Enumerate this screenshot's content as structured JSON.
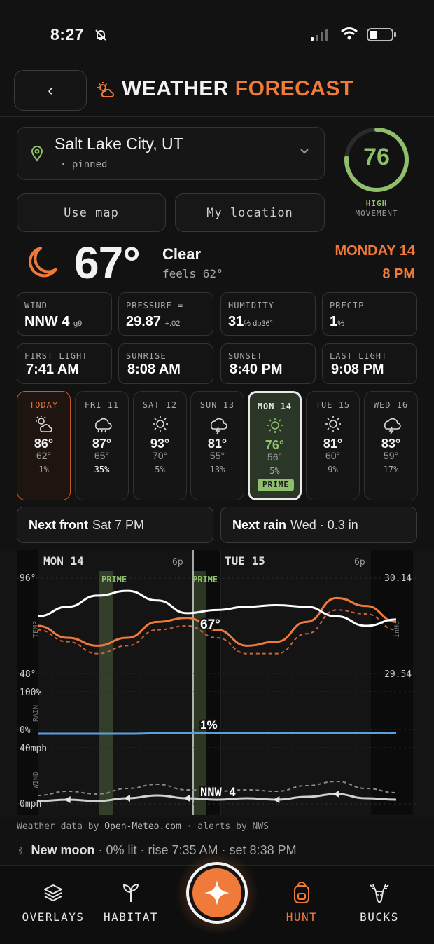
{
  "status": {
    "time": "8:27"
  },
  "header": {
    "title_main": "WEATHER",
    "title_accent": "FORECAST"
  },
  "location": {
    "name": "Salt Lake City, UT",
    "sub": "· pinned"
  },
  "movement": {
    "score": "76",
    "level": "HIGH",
    "label": "MOVEMENT",
    "fraction": 0.76
  },
  "buttons": {
    "use_map": "Use map",
    "my_location": "My location"
  },
  "current": {
    "temp": "67°",
    "condition": "Clear",
    "feels": "feels 62°",
    "date_day": "MONDAY 14",
    "date_time": "8 PM"
  },
  "tiles": [
    {
      "label": "WIND",
      "value": "NNW 4",
      "extra": "g9"
    },
    {
      "label": "PRESSURE =",
      "value": "29.87",
      "extra": "+.02"
    },
    {
      "label": "HUMIDITY",
      "value": "31",
      "extra": "% dp36°"
    },
    {
      "label": "PRECIP",
      "value": "1",
      "extra": "%"
    }
  ],
  "light": [
    {
      "label": "FIRST LIGHT",
      "value": "7:41 AM"
    },
    {
      "label": "SUNRISE",
      "value": "8:08 AM"
    },
    {
      "label": "SUNSET",
      "value": "8:40 PM"
    },
    {
      "label": "LAST LIGHT",
      "value": "9:08 PM"
    }
  ],
  "days": [
    {
      "name": "TODAY",
      "icon": "partly-cloudy-icon",
      "high": "86°",
      "low": "62°",
      "precip": "1%"
    },
    {
      "name": "FRI 11",
      "icon": "rain-cloud-icon",
      "high": "87°",
      "low": "65°",
      "precip": "35%"
    },
    {
      "name": "SAT 12",
      "icon": "sun-icon",
      "high": "93°",
      "low": "70°",
      "precip": "5%"
    },
    {
      "name": "SUN 13",
      "icon": "thunder-cloud-icon",
      "high": "81°",
      "low": "55°",
      "precip": "13%"
    },
    {
      "name": "MON 14",
      "icon": "sun-icon",
      "high": "76°",
      "low": "56°",
      "precip": "5%",
      "badge": "PRIME"
    },
    {
      "name": "TUE 15",
      "icon": "sun-icon",
      "high": "81°",
      "low": "60°",
      "precip": "9%"
    },
    {
      "name": "WED 16",
      "icon": "thunder-cloud-icon",
      "high": "83°",
      "low": "59°",
      "precip": "17%"
    }
  ],
  "notes": {
    "front_label": "Next front",
    "front_value": "Sat 7 PM",
    "rain_label": "Next rain",
    "rain_value": "Wed · 0.3 in"
  },
  "chart_labels": {
    "day1": "MON 14",
    "day2": "TUE 15",
    "tick_6p": "6p",
    "temp_max": "96°",
    "temp_min": "48°",
    "temp_axis": "TEMP",
    "press_max": "30.14",
    "press_min": "29.54",
    "press_axis": "inHg",
    "rain_max": "100%",
    "rain_min": "0%",
    "rain_axis": "RAIN",
    "wind_max": "40mph",
    "wind_min": "0mph",
    "wind_axis": "WIND",
    "prime": "PRIME",
    "cur_temp": "67°",
    "cur_rain": "1%",
    "cur_wind": "NNW  4"
  },
  "chart_data": {
    "type": "line",
    "x": [
      "Mon 12a",
      "Mon 4a",
      "Mon 8a",
      "Mon 12p",
      "Mon 4p",
      "Mon 8p",
      "Tue 12a",
      "Tue 4a",
      "Tue 8a",
      "Tue 12p",
      "Tue 4p",
      "Tue 8p",
      "Wed 12a"
    ],
    "temp_ylim": [
      48,
      96
    ],
    "pressure_ylim": [
      29.54,
      30.14
    ],
    "series": [
      {
        "name": "temp",
        "values": [
          72,
          66,
          62,
          66,
          74,
          76,
          70,
          62,
          64,
          74,
          86,
          82,
          74
        ]
      },
      {
        "name": "feels",
        "values": [
          70,
          64,
          58,
          62,
          70,
          72,
          66,
          58,
          58,
          68,
          80,
          78,
          70
        ]
      },
      {
        "name": "pressure",
        "values": [
          29.9,
          29.96,
          30.03,
          30.06,
          30.0,
          29.92,
          29.94,
          29.96,
          29.97,
          29.96,
          29.9,
          29.84,
          29.88
        ]
      },
      {
        "name": "rain",
        "values": [
          0,
          0,
          0,
          0,
          1,
          1,
          1,
          1,
          1,
          1,
          1,
          1,
          1
        ]
      },
      {
        "name": "wind",
        "values": [
          2,
          3,
          2,
          4,
          6,
          4,
          3,
          4,
          3,
          5,
          7,
          4,
          3
        ]
      },
      {
        "name": "gust",
        "values": [
          6,
          9,
          7,
          11,
          14,
          10,
          9,
          10,
          9,
          13,
          16,
          11,
          8
        ]
      }
    ],
    "wind_ylim": [
      0,
      40
    ],
    "rain_ylim": [
      0,
      100
    ]
  },
  "attribution": {
    "prefix": "Weather data by",
    "link": "Open-Meteo.com",
    "suffix": "· alerts by NWS"
  },
  "moon": {
    "phase": "New moon",
    "details": "· 0% lit · rise 7:35 AM · set 8:38 PM"
  },
  "nav": {
    "overlays": "OVERLAYS",
    "habitat": "HABITAT",
    "hunt": "HUNT",
    "bucks": "BUCKS"
  },
  "colors": {
    "accent": "#f07a3a",
    "prime": "#8fbf6c",
    "rain": "#5aa0e0"
  }
}
